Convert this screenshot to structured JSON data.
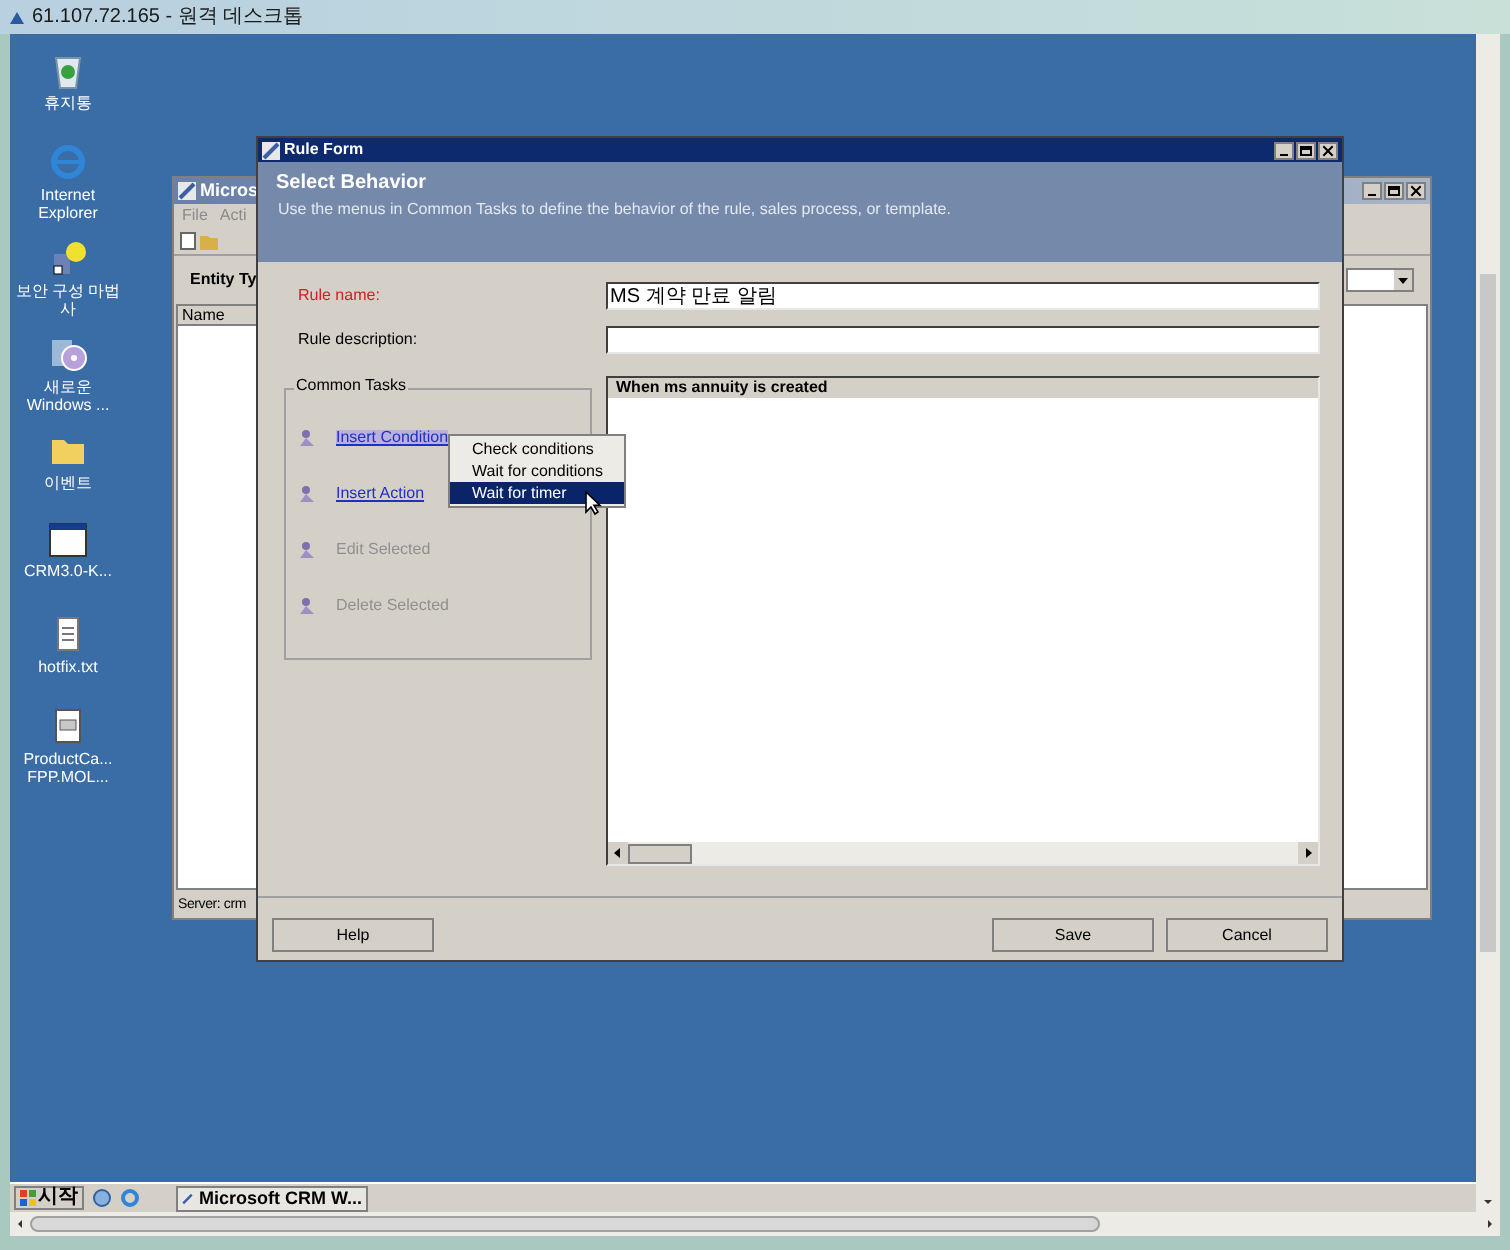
{
  "remote_window": {
    "title": "61.107.72.165 - 원격 데스크톱"
  },
  "desktop_icons": [
    {
      "kind": "recycle",
      "label": "휴지통"
    },
    {
      "kind": "browser",
      "label": "Internet Explorer"
    },
    {
      "kind": "wizard",
      "label": "보안 구성 마법사"
    },
    {
      "kind": "installer",
      "label": "새로운 Windows ..."
    },
    {
      "kind": "folder",
      "label": "이벤트"
    },
    {
      "kind": "window",
      "label": "CRM3.0-K..."
    },
    {
      "kind": "text",
      "label": "hotfix.txt"
    },
    {
      "kind": "document",
      "label": "ProductCa... FPP.MOL..."
    }
  ],
  "background_window": {
    "title": "Micros",
    "menu": [
      "File",
      "Acti"
    ],
    "section_label": "Entity Ty",
    "column": "Name",
    "status": "Server: crm"
  },
  "dialog": {
    "title": "Rule Form",
    "header": "Select Behavior",
    "description": "Use the menus in Common Tasks to define the behavior of the rule, sales process, or template.",
    "fields": [
      {
        "label": "Rule name:",
        "required": true,
        "value": "MS 계약 만료 알림"
      },
      {
        "label": "Rule description:",
        "required": false
      }
    ],
    "common_tasks": {
      "title": "Common Tasks",
      "items": [
        {
          "label": "Insert Condition",
          "disabled": false,
          "focused": true
        },
        {
          "label": "Insert Action",
          "disabled": false,
          "focused": false
        },
        {
          "label": "Edit Selected",
          "disabled": true,
          "focused": false
        },
        {
          "label": "Delete Selected",
          "disabled": true,
          "focused": false
        }
      ]
    },
    "rule_pane": {
      "header": "When ms annuity is created"
    },
    "context_menu": [
      {
        "label": "Check conditions",
        "selected": false
      },
      {
        "label": "Wait for conditions",
        "selected": false
      },
      {
        "label": "Wait for timer",
        "selected": true
      }
    ],
    "buttons": [
      "Help",
      "Save",
      "Cancel"
    ]
  },
  "taskbar": {
    "start": "시작",
    "tasks": [
      "Microsoft CRM W..."
    ]
  }
}
